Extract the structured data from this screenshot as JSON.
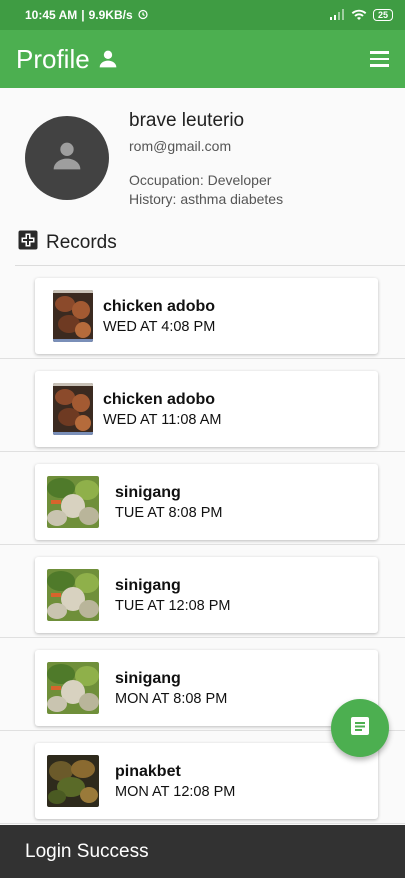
{
  "status_bar": {
    "time": "10:45 AM",
    "speed": "9.9KB/s",
    "battery": "25"
  },
  "app_bar": {
    "title": "Profile"
  },
  "profile": {
    "name": "brave leuterio",
    "email": "rom@gmail.com",
    "occupation": "Occupation: Developer",
    "history": "History: asthma diabetes"
  },
  "records_section": {
    "title": "Records"
  },
  "records": [
    {
      "name": "chicken adobo",
      "time": "WED AT 4:08 PM",
      "thumb": "adobo"
    },
    {
      "name": "chicken adobo",
      "time": "WED AT 11:08 AM",
      "thumb": "adobo"
    },
    {
      "name": "sinigang",
      "time": "TUE AT 8:08 PM",
      "thumb": "sinigang"
    },
    {
      "name": "sinigang",
      "time": "TUE AT 12:08 PM",
      "thumb": "sinigang"
    },
    {
      "name": "sinigang",
      "time": "MON AT 8:08 PM",
      "thumb": "sinigang"
    },
    {
      "name": "pinakbet",
      "time": "MON AT 12:08 PM",
      "thumb": "pinakbet"
    }
  ],
  "snackbar": {
    "message": "Login Success"
  },
  "colors": {
    "primary": "#4caf50",
    "status_bar": "#3f9c43",
    "snackbar": "#323232"
  }
}
